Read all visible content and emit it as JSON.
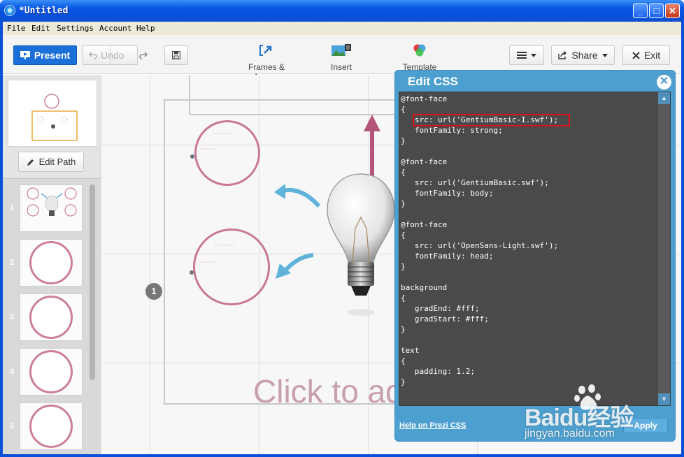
{
  "window": {
    "title": "*Untitled",
    "controls": {
      "minimize": "_",
      "maximize": "□",
      "close": "✕"
    }
  },
  "menu": [
    "File",
    "Edit",
    "Settings",
    "Account",
    "Help"
  ],
  "toolbar": {
    "present_label": "Present",
    "undo_label": "Undo",
    "frames_label": "Frames & Arrows",
    "insert_label": "Insert",
    "template_label": "Template",
    "share_label": "Share",
    "exit_label": "Exit"
  },
  "sidebar": {
    "edit_path_label": "Edit Path",
    "slides": [
      "1",
      "2",
      "3",
      "4",
      "5"
    ]
  },
  "canvas": {
    "step_number": "1",
    "placeholder_text": "Click to ad"
  },
  "css_panel": {
    "title": "Edit CSS",
    "code_lines": [
      "@font-face",
      "{",
      "   src: url('GentiumBasic-I.swf');",
      "   fontFamily: strong;",
      "}",
      "",
      "@font-face",
      "{",
      "   src: url('GentiumBasic.swf');",
      "   fontFamily: body;",
      "}",
      "",
      "@font-face",
      "{",
      "   src: url('OpenSans-Light.swf');",
      "   fontFamily: head;",
      "}",
      "",
      "background",
      "{",
      "   gradEnd: #fff;",
      "   gradStart: #fff;",
      "}",
      "",
      "text",
      "{",
      "   padding: 1.2;",
      "}"
    ],
    "help_link": "Help on Prezi CSS",
    "apply_label": "Apply"
  },
  "watermark": {
    "brand": "Baidu经验",
    "url": "jingyan.baidu.com"
  },
  "colors": {
    "accent": "#1a6fd8",
    "panel": "#4d9fcf",
    "circle": "#c87894",
    "arrow_blue": "#5fb3d9",
    "arrow_pink": "#b5547a"
  },
  "icons": [
    "present-icon",
    "undo-icon",
    "redo-icon",
    "save-icon",
    "frames-arrows-icon",
    "insert-icon",
    "template-icon",
    "menu-icon",
    "share-icon",
    "close-x-icon",
    "pencil-icon"
  ]
}
